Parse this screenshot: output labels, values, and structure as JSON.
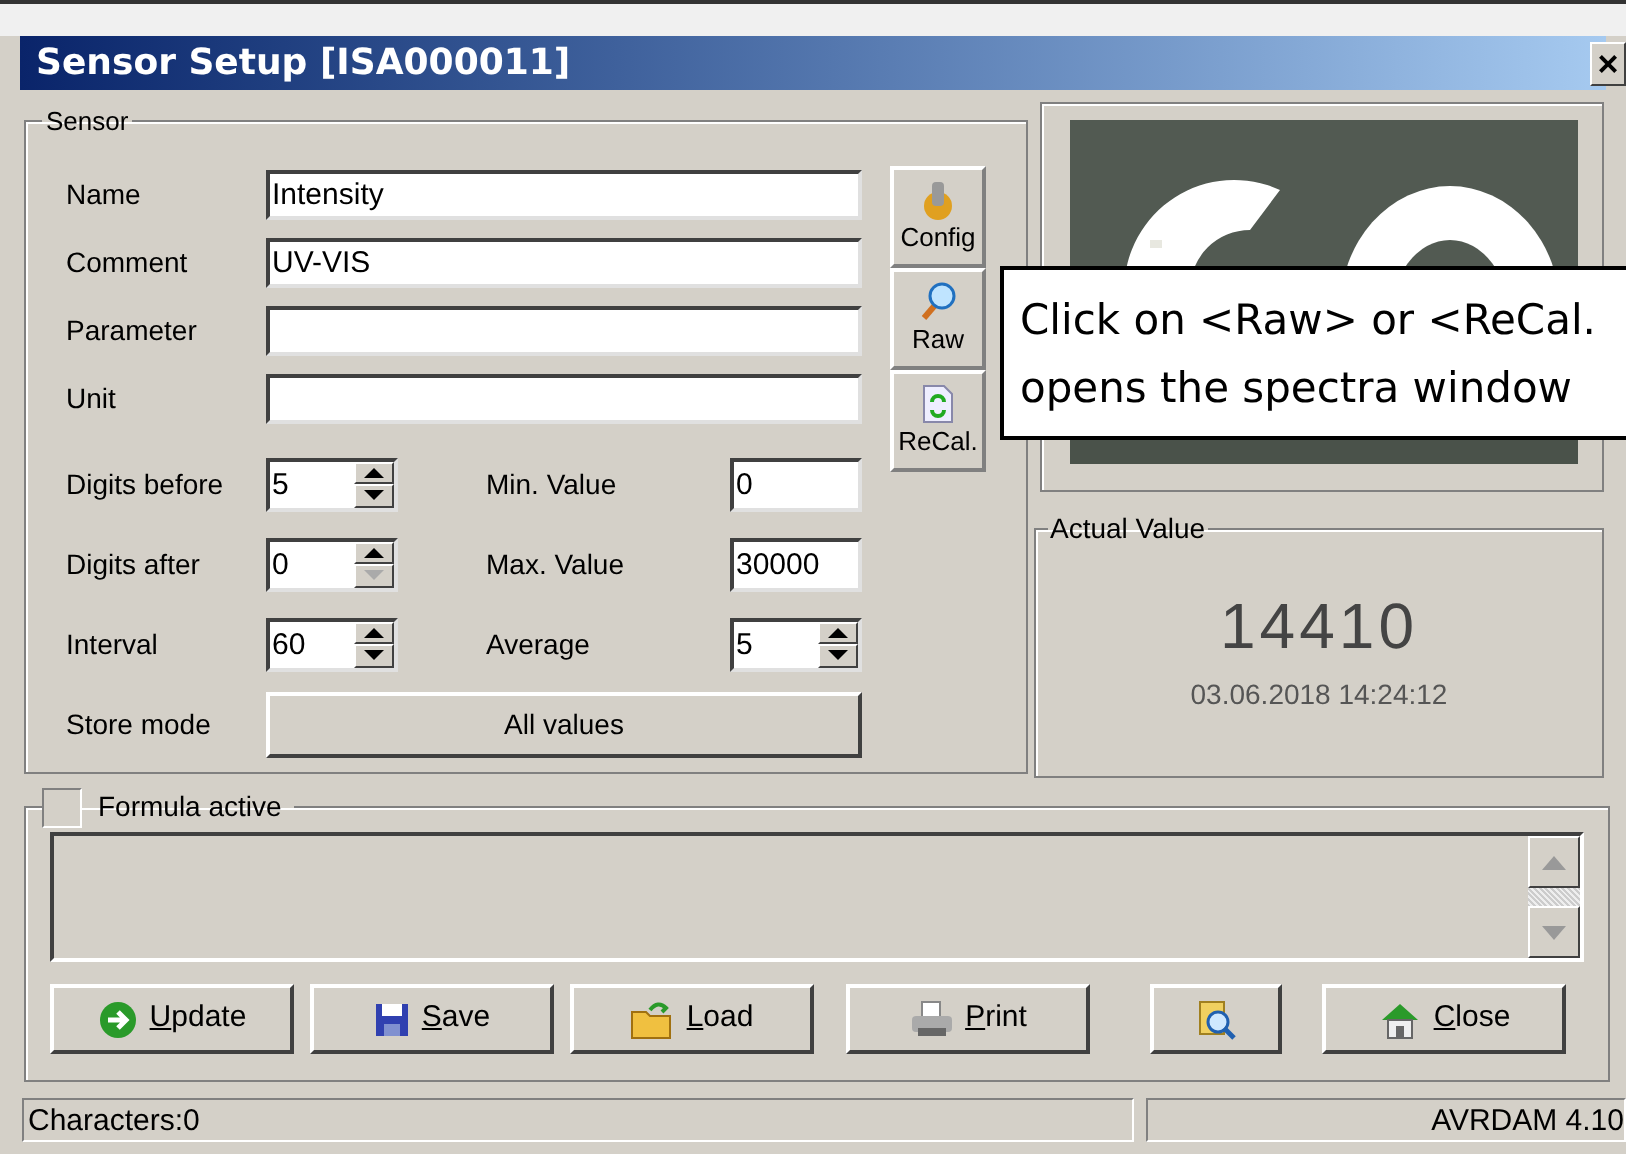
{
  "window": {
    "title": "Sensor Setup [ISA000011]",
    "close": "×"
  },
  "sensor": {
    "legend": "Sensor",
    "fields": [
      {
        "label": "Name",
        "value": "Intensity"
      },
      {
        "label": "Comment",
        "value": "UV-VIS"
      },
      {
        "label": "Parameter"
      },
      {
        "label": "Unit"
      }
    ],
    "numbers": [
      [
        {
          "label": "Digits before",
          "value": "5",
          "kind": "spin",
          "down_disabled": false
        },
        {
          "label": "Min. Value",
          "value": "0",
          "kind": "text"
        }
      ],
      [
        {
          "label": "Digits after",
          "value": "0",
          "kind": "spin",
          "down_disabled": true
        },
        {
          "label": "Max. Value",
          "value": "30000",
          "kind": "text"
        }
      ],
      [
        {
          "label": "Interval",
          "value": "60",
          "kind": "spin",
          "down_disabled": false
        },
        {
          "label": "Average",
          "value": "5",
          "kind": "spin",
          "down_disabled": false
        }
      ]
    ],
    "store_mode": {
      "label": "Store mode",
      "value": "All values"
    },
    "side_buttons": [
      "Config",
      "Raw",
      "ReCal."
    ]
  },
  "actual_value": {
    "legend": "Actual Value",
    "value": "14410",
    "timestamp": "03.06.2018 14:24:12"
  },
  "tooltip": [
    "Click on <Raw> or <ReCal.",
    "opens the spectra window"
  ],
  "formula": {
    "label": "Formula active",
    "checked": false
  },
  "buttons": [
    {
      "kind": "text",
      "label": "Update"
    },
    {
      "kind": "text",
      "label": "Save"
    },
    {
      "kind": "text",
      "label": "Load"
    },
    {
      "kind": "text",
      "label": "Print"
    },
    {
      "kind": "icon"
    },
    {
      "kind": "text",
      "label": "Close"
    }
  ],
  "status_bar": [
    "Characters:0",
    "AVRDAM 4.10"
  ]
}
